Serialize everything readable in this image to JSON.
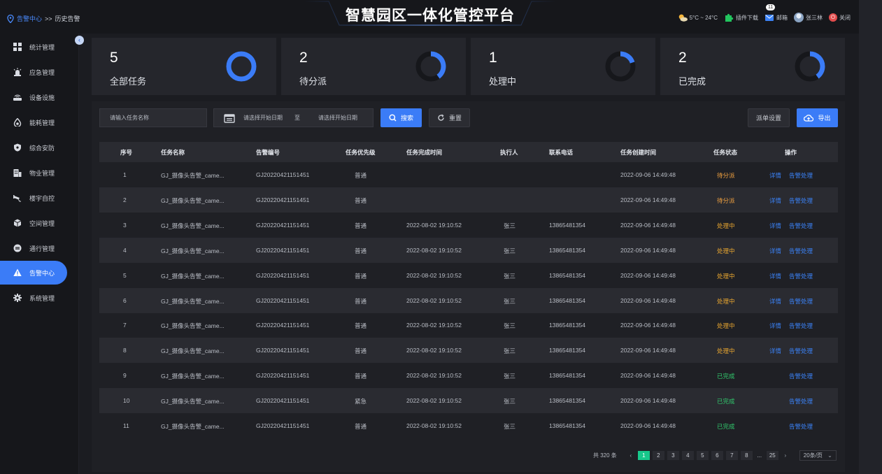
{
  "header": {
    "breadcrumb": {
      "parent": "告警中心",
      "sep": ">>",
      "current": "历史告警"
    },
    "title": "智慧园区一体化管控平台",
    "weather": "5°C ~ 24°C",
    "plugin_download": "插件下载",
    "mail_badge": "11",
    "mail_label": "邮箱",
    "user_name": "张三林",
    "logout_label": "关闭"
  },
  "sidebar": {
    "items": [
      {
        "label": "统计管理",
        "icon": "grid-icon"
      },
      {
        "label": "应急管理",
        "icon": "alarm-light-icon"
      },
      {
        "label": "设备设施",
        "icon": "router-icon"
      },
      {
        "label": "能耗管理",
        "icon": "drop-icon"
      },
      {
        "label": "综合安防",
        "icon": "shield-icon"
      },
      {
        "label": "物业管理",
        "icon": "building-icon"
      },
      {
        "label": "楼宇自控",
        "icon": "camera-icon"
      },
      {
        "label": "空间管理",
        "icon": "cube-icon"
      },
      {
        "label": "通行管理",
        "icon": "gate-icon"
      },
      {
        "label": "告警中心",
        "icon": "warning-icon",
        "active": true
      },
      {
        "label": "系统管理",
        "icon": "gear-icon"
      }
    ]
  },
  "stats": [
    {
      "value": "5",
      "label": "全部任务",
      "ratio": 1.0
    },
    {
      "value": "2",
      "label": "待分派",
      "ratio": 0.4
    },
    {
      "value": "1",
      "label": "处理中",
      "ratio": 0.2
    },
    {
      "value": "2",
      "label": "已完成",
      "ratio": 0.4
    }
  ],
  "filters": {
    "task_name_placeholder": "请输入任务名称",
    "start_date_placeholder": "请选择开始日期",
    "range_sep": "至",
    "end_date_placeholder": "请选择开始日期",
    "search_label": "搜索",
    "reset_label": "重置",
    "dispatch_settings_label": "派单设置",
    "export_label": "导出"
  },
  "table": {
    "columns": [
      "序号",
      "任务名称",
      "告警编号",
      "任务优先级",
      "任务完成时间",
      "执行人",
      "联系电话",
      "任务创建时间",
      "任务状态",
      "操作"
    ],
    "rows": [
      {
        "no": "1",
        "name": "GJ_摄像头告警_came...",
        "code": "GJ20220421151451",
        "priority": "普通",
        "finish_time": "",
        "executor": "",
        "phone": "",
        "created": "2022-09-06  14:49:48",
        "status": "待分派",
        "status_type": "pending",
        "detail": "详情",
        "action": "告警处理"
      },
      {
        "no": "2",
        "name": "GJ_摄像头告警_came...",
        "code": "GJ20220421151451",
        "priority": "普通",
        "finish_time": "",
        "executor": "",
        "phone": "",
        "created": "2022-09-06  14:49:48",
        "status": "待分派",
        "status_type": "pending",
        "detail": "详情",
        "action": "告警处理"
      },
      {
        "no": "3",
        "name": "GJ_摄像头告警_came...",
        "code": "GJ20220421151451",
        "priority": "普通",
        "finish_time": "2022-08-02  19:10:52",
        "executor": "张三",
        "phone": "13865481354",
        "created": "2022-09-06  14:49:48",
        "status": "处理中",
        "status_type": "processing",
        "detail": "详情",
        "action": "告警处理"
      },
      {
        "no": "4",
        "name": "GJ_摄像头告警_came...",
        "code": "GJ20220421151451",
        "priority": "普通",
        "finish_time": "2022-08-02  19:10:52",
        "executor": "张三",
        "phone": "13865481354",
        "created": "2022-09-06  14:49:48",
        "status": "处理中",
        "status_type": "processing",
        "detail": "详情",
        "action": "告警处理"
      },
      {
        "no": "5",
        "name": "GJ_摄像头告警_came...",
        "code": "GJ20220421151451",
        "priority": "普通",
        "finish_time": "2022-08-02  19:10:52",
        "executor": "张三",
        "phone": "13865481354",
        "created": "2022-09-06  14:49:48",
        "status": "处理中",
        "status_type": "processing",
        "detail": "详情",
        "action": "告警处理"
      },
      {
        "no": "6",
        "name": "GJ_摄像头告警_came...",
        "code": "GJ20220421151451",
        "priority": "普通",
        "finish_time": "2022-08-02  19:10:52",
        "executor": "张三",
        "phone": "13865481354",
        "created": "2022-09-06  14:49:48",
        "status": "处理中",
        "status_type": "processing",
        "detail": "详情",
        "action": "告警处理"
      },
      {
        "no": "7",
        "name": "GJ_摄像头告警_came...",
        "code": "GJ20220421151451",
        "priority": "普通",
        "finish_time": "2022-08-02  19:10:52",
        "executor": "张三",
        "phone": "13865481354",
        "created": "2022-09-06  14:49:48",
        "status": "处理中",
        "status_type": "processing",
        "detail": "详情",
        "action": "告警处理"
      },
      {
        "no": "8",
        "name": "GJ_摄像头告警_came...",
        "code": "GJ20220421151451",
        "priority": "普通",
        "finish_time": "2022-08-02  19:10:52",
        "executor": "张三",
        "phone": "13865481354",
        "created": "2022-09-06  14:49:48",
        "status": "处理中",
        "status_type": "processing",
        "detail": "详情",
        "action": "告警处理"
      },
      {
        "no": "9",
        "name": "GJ_摄像头告警_came...",
        "code": "GJ20220421151451",
        "priority": "普通",
        "finish_time": "2022-08-02  19:10:52",
        "executor": "张三",
        "phone": "13865481354",
        "created": "2022-09-06  14:49:48",
        "status": "已完成",
        "status_type": "done",
        "detail": "",
        "action": "告警处理"
      },
      {
        "no": "10",
        "name": "GJ_摄像头告警_came...",
        "code": "GJ20220421151451",
        "priority": "紧急",
        "finish_time": "2022-08-02  19:10:52",
        "executor": "张三",
        "phone": "13865481354",
        "created": "2022-09-06  14:49:48",
        "status": "已完成",
        "status_type": "done",
        "detail": "",
        "action": "告警处理"
      },
      {
        "no": "11",
        "name": "GJ_摄像头告警_came...",
        "code": "GJ20220421151451",
        "priority": "普通",
        "finish_time": "2022-08-02  19:10:52",
        "executor": "张三",
        "phone": "13865481354",
        "created": "2022-09-06  14:49:48",
        "status": "已完成",
        "status_type": "done",
        "detail": "",
        "action": "告警处理"
      }
    ]
  },
  "pagination": {
    "total_text": "共 320 条",
    "pages": [
      "1",
      "2",
      "3",
      "4",
      "5",
      "6",
      "7",
      "8",
      "...",
      "25"
    ],
    "current_page": "1",
    "page_size": "20条/页"
  },
  "colors": {
    "accent": "#3b7cf7",
    "pending": "#f0a040",
    "processing": "#e8a630",
    "done": "#31c96d",
    "page_active": "#17c78a"
  }
}
